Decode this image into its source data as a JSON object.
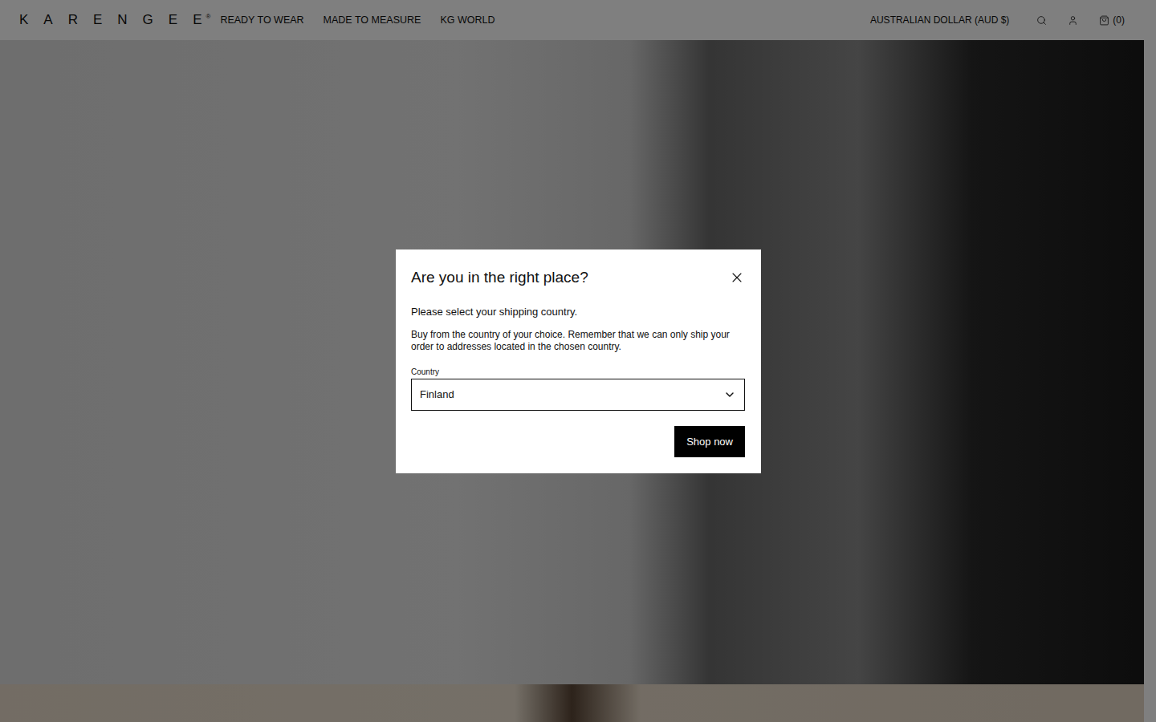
{
  "header": {
    "logo": "KARENGEE",
    "logo_mark": "®",
    "nav": [
      "READY TO WEAR",
      "MADE TO MEASURE",
      "KG WORLD"
    ],
    "currency": "AUSTRALIAN DOLLAR (AUD $)",
    "cart_count": "(0)"
  },
  "modal": {
    "title": "Are you in the right place?",
    "subtitle": "Please select your shipping country.",
    "body": "Buy from the country of your choice. Remember that we can only ship your order to addresses located in the chosen country.",
    "field_label": "Country",
    "country": "Finland",
    "button": "Shop now"
  }
}
